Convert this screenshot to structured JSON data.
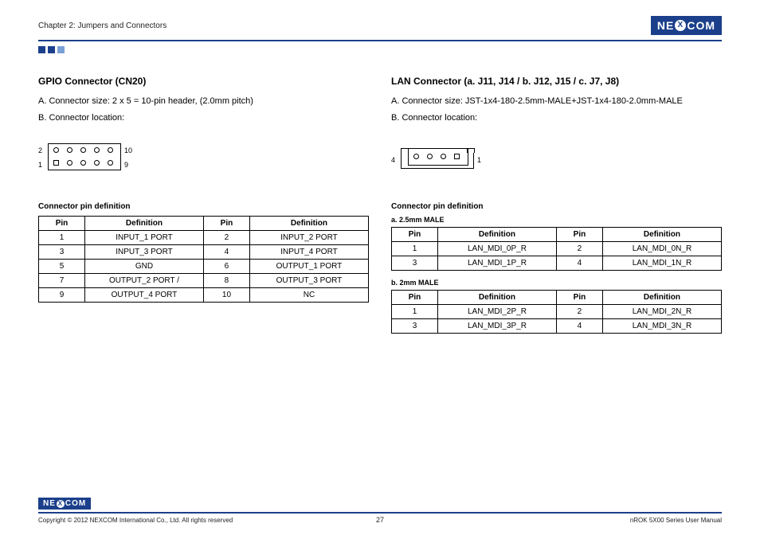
{
  "header": {
    "chapter": "Chapter 2: Jumpers and Connectors",
    "brand_pre": "NE",
    "brand_x": "X",
    "brand_post": "COM"
  },
  "left": {
    "title": "GPIO Connector (CN20)",
    "lineA": "A. Connector size: 2 x 5 = 10-pin header, (2.0mm pitch)",
    "lineB": "B. Connector location:",
    "dia": {
      "l2": "2",
      "l1": "1",
      "r10": "10",
      "r9": "9"
    },
    "sub": "Connector pin definition",
    "th": {
      "pin": "Pin",
      "def": "Definition"
    },
    "rows": [
      {
        "p1": "1",
        "d1": "INPUT_1 PORT",
        "p2": "2",
        "d2": "INPUT_2 PORT"
      },
      {
        "p1": "3",
        "d1": "INPUT_3 PORT",
        "p2": "4",
        "d2": "INPUT_4 PORT"
      },
      {
        "p1": "5",
        "d1": "GND",
        "p2": "6",
        "d2": "OUTPUT_1 PORT"
      },
      {
        "p1": "7",
        "d1": "OUTPUT_2 PORT /",
        "p2": "8",
        "d2": "OUTPUT_3 PORT"
      },
      {
        "p1": "9",
        "d1": "OUTPUT_4 PORT",
        "p2": "10",
        "d2": "NC"
      }
    ]
  },
  "right": {
    "title": "LAN Connector (a. J11, J14 / b. J12, J15 / c. J7, J8)",
    "lineA": "A. Connector size: JST-1x4-180-2.5mm-MALE+JST-1x4-180-2.0mm-MALE",
    "lineB": "B. Connector location:",
    "dia": {
      "l": "4",
      "r": "1"
    },
    "sub": "Connector pin definition",
    "subA": "a. 2.5mm MALE",
    "subB": "b. 2mm MALE",
    "th": {
      "pin": "Pin",
      "def": "Definition"
    },
    "rowsA": [
      {
        "p1": "1",
        "d1": "LAN_MDI_0P_R",
        "p2": "2",
        "d2": "LAN_MDI_0N_R"
      },
      {
        "p1": "3",
        "d1": "LAN_MDI_1P_R",
        "p2": "4",
        "d2": "LAN_MDI_1N_R"
      }
    ],
    "rowsB": [
      {
        "p1": "1",
        "d1": "LAN_MDI_2P_R",
        "p2": "2",
        "d2": "LAN_MDI_2N_R"
      },
      {
        "p1": "3",
        "d1": "LAN_MDI_3P_R",
        "p2": "4",
        "d2": "LAN_MDI_3N_R"
      }
    ]
  },
  "footer": {
    "copyright": "Copyright © 2012 NEXCOM International Co., Ltd. All rights reserved",
    "page": "27",
    "manual": "nROK 5X00 Series User Manual"
  }
}
